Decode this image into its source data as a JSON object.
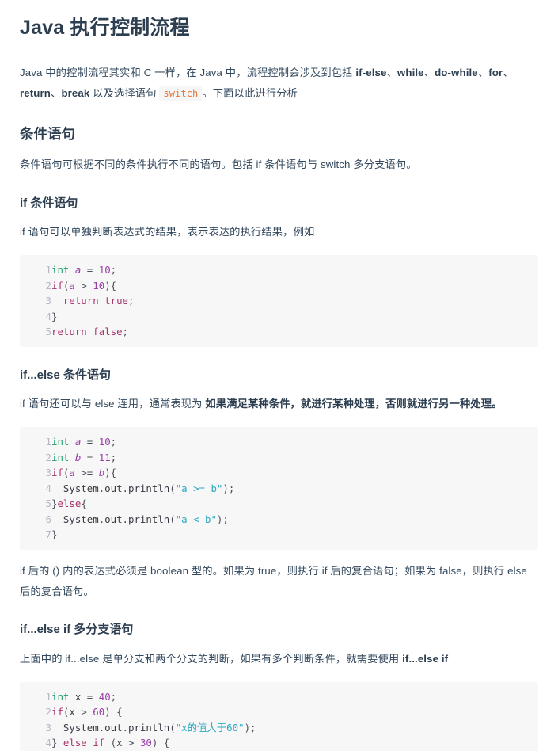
{
  "document": {
    "title": "Java 执行控制流程",
    "intro": {
      "seg1": "Java 中的控制流程其实和 C 一样，在 Java 中，流程控制会涉及到包括 ",
      "kw1": "if-else",
      "sep1": "、",
      "kw2": "while",
      "sep2": "、",
      "kw3": "do-while",
      "sep3": "、",
      "kw4": "for",
      "sep4": "、",
      "kw5": "return",
      "sep5": "、",
      "kw6": "break",
      "seg2": " 以及选择语句 ",
      "code": "switch",
      "seg3": "。下面以此进行分析"
    },
    "sections": [
      {
        "heading": "条件语句",
        "paragraph": "条件语句可根据不同的条件执行不同的语句。包括 if 条件语句与 switch 多分支语句。"
      }
    ],
    "sub_if": {
      "heading": "if 条件语句",
      "paragraph": "if 语句可以单独判断表达式的结果，表示表达的执行结果，例如"
    },
    "sub_ifelse": {
      "heading": "if...else 条件语句",
      "para_pre": "if 语句还可以与 else 连用，通常表现为 ",
      "para_bold": "如果满足某种条件，就进行某种处理，否则就进行另一种处理。",
      "para_after": "if 后的 () 内的表达式必须是 boolean 型的。如果为 true，则执行 if 后的复合语句；如果为 false，则执行 else 后的复合语句。"
    },
    "sub_elseif": {
      "heading": "if...else if 多分支语句",
      "para_pre": "上面中的 if...else 是单分支和两个分支的判断，如果有多个判断条件，就需要使用 ",
      "para_bold": "if...else if"
    },
    "code_blocks": [
      {
        "name": "if-example",
        "lines": [
          {
            "no": "1",
            "tokens": [
              {
                "t": "int",
                "c": "kw"
              },
              {
                "t": " ",
                "c": "punc"
              },
              {
                "t": "a",
                "c": "var"
              },
              {
                "t": " ",
                "c": "punc"
              },
              {
                "t": "=",
                "c": "op"
              },
              {
                "t": " ",
                "c": "punc"
              },
              {
                "t": "10",
                "c": "num"
              },
              {
                "t": ";",
                "c": "punc"
              }
            ]
          },
          {
            "no": "2",
            "tokens": [
              {
                "t": "if",
                "c": "ctrl"
              },
              {
                "t": "(",
                "c": "punc"
              },
              {
                "t": "a",
                "c": "var"
              },
              {
                "t": " ",
                "c": "punc"
              },
              {
                "t": ">",
                "c": "op"
              },
              {
                "t": " ",
                "c": "punc"
              },
              {
                "t": "10",
                "c": "num"
              },
              {
                "t": "){",
                "c": "punc"
              }
            ]
          },
          {
            "no": "3",
            "tokens": [
              {
                "t": "  ",
                "c": "punc"
              },
              {
                "t": "return",
                "c": "ctrl"
              },
              {
                "t": " ",
                "c": "punc"
              },
              {
                "t": "true",
                "c": "bool"
              },
              {
                "t": ";",
                "c": "punc"
              }
            ]
          },
          {
            "no": "4",
            "tokens": [
              {
                "t": "}",
                "c": "punc"
              }
            ]
          },
          {
            "no": "5",
            "tokens": [
              {
                "t": "return",
                "c": "ctrl"
              },
              {
                "t": " ",
                "c": "punc"
              },
              {
                "t": "false",
                "c": "bool"
              },
              {
                "t": ";",
                "c": "punc"
              }
            ]
          }
        ]
      },
      {
        "name": "if-else-example",
        "lines": [
          {
            "no": "1",
            "tokens": [
              {
                "t": "int",
                "c": "kw"
              },
              {
                "t": " ",
                "c": "punc"
              },
              {
                "t": "a",
                "c": "var"
              },
              {
                "t": " ",
                "c": "punc"
              },
              {
                "t": "=",
                "c": "op"
              },
              {
                "t": " ",
                "c": "punc"
              },
              {
                "t": "10",
                "c": "num"
              },
              {
                "t": ";",
                "c": "punc"
              }
            ]
          },
          {
            "no": "2",
            "tokens": [
              {
                "t": "int",
                "c": "kw"
              },
              {
                "t": " ",
                "c": "punc"
              },
              {
                "t": "b",
                "c": "var"
              },
              {
                "t": " ",
                "c": "punc"
              },
              {
                "t": "=",
                "c": "op"
              },
              {
                "t": " ",
                "c": "punc"
              },
              {
                "t": "11",
                "c": "num"
              },
              {
                "t": ";",
                "c": "punc"
              }
            ]
          },
          {
            "no": "3",
            "tokens": [
              {
                "t": "if",
                "c": "ctrl"
              },
              {
                "t": "(",
                "c": "punc"
              },
              {
                "t": "a",
                "c": "var"
              },
              {
                "t": " ",
                "c": "punc"
              },
              {
                "t": ">=",
                "c": "op"
              },
              {
                "t": " ",
                "c": "punc"
              },
              {
                "t": "b",
                "c": "var"
              },
              {
                "t": "){",
                "c": "punc"
              }
            ]
          },
          {
            "no": "4",
            "tokens": [
              {
                "t": "  ",
                "c": "punc"
              },
              {
                "t": "System",
                "c": "id"
              },
              {
                "t": ".",
                "c": "punc"
              },
              {
                "t": "out",
                "c": "id"
              },
              {
                "t": ".",
                "c": "punc"
              },
              {
                "t": "println",
                "c": "id"
              },
              {
                "t": "(",
                "c": "punc"
              },
              {
                "t": "\"a >= b\"",
                "c": "str"
              },
              {
                "t": ");",
                "c": "punc"
              }
            ]
          },
          {
            "no": "5",
            "tokens": [
              {
                "t": "}",
                "c": "punc"
              },
              {
                "t": "else",
                "c": "ctrl"
              },
              {
                "t": "{",
                "c": "punc"
              }
            ]
          },
          {
            "no": "6",
            "tokens": [
              {
                "t": "  ",
                "c": "punc"
              },
              {
                "t": "System",
                "c": "id"
              },
              {
                "t": ".",
                "c": "punc"
              },
              {
                "t": "out",
                "c": "id"
              },
              {
                "t": ".",
                "c": "punc"
              },
              {
                "t": "println",
                "c": "id"
              },
              {
                "t": "(",
                "c": "punc"
              },
              {
                "t": "\"a < b\"",
                "c": "str"
              },
              {
                "t": ");",
                "c": "punc"
              }
            ]
          },
          {
            "no": "7",
            "tokens": [
              {
                "t": "}",
                "c": "punc"
              }
            ]
          }
        ]
      },
      {
        "name": "else-if-example",
        "lines": [
          {
            "no": "1",
            "tokens": [
              {
                "t": "int",
                "c": "kw"
              },
              {
                "t": " ",
                "c": "punc"
              },
              {
                "t": "x",
                "c": "id"
              },
              {
                "t": " ",
                "c": "punc"
              },
              {
                "t": "=",
                "c": "op"
              },
              {
                "t": " ",
                "c": "punc"
              },
              {
                "t": "40",
                "c": "num"
              },
              {
                "t": ";",
                "c": "punc"
              }
            ]
          },
          {
            "no": "2",
            "tokens": [
              {
                "t": "if",
                "c": "ctrl"
              },
              {
                "t": "(",
                "c": "punc"
              },
              {
                "t": "x",
                "c": "id"
              },
              {
                "t": " ",
                "c": "punc"
              },
              {
                "t": ">",
                "c": "op"
              },
              {
                "t": " ",
                "c": "punc"
              },
              {
                "t": "60",
                "c": "num"
              },
              {
                "t": ") {",
                "c": "punc"
              }
            ]
          },
          {
            "no": "3",
            "tokens": [
              {
                "t": "  ",
                "c": "punc"
              },
              {
                "t": "System",
                "c": "id"
              },
              {
                "t": ".",
                "c": "punc"
              },
              {
                "t": "out",
                "c": "id"
              },
              {
                "t": ".",
                "c": "punc"
              },
              {
                "t": "println",
                "c": "id"
              },
              {
                "t": "(",
                "c": "punc"
              },
              {
                "t": "\"x的值大于60\"",
                "c": "str"
              },
              {
                "t": ");",
                "c": "punc"
              }
            ]
          },
          {
            "no": "4",
            "tokens": [
              {
                "t": "} ",
                "c": "punc"
              },
              {
                "t": "else",
                "c": "ctrl"
              },
              {
                "t": " ",
                "c": "punc"
              },
              {
                "t": "if",
                "c": "ctrl"
              },
              {
                "t": " (",
                "c": "punc"
              },
              {
                "t": "x",
                "c": "id"
              },
              {
                "t": " ",
                "c": "punc"
              },
              {
                "t": ">",
                "c": "op"
              },
              {
                "t": " ",
                "c": "punc"
              },
              {
                "t": "30",
                "c": "num"
              },
              {
                "t": ") {",
                "c": "punc"
              }
            ]
          }
        ]
      }
    ]
  },
  "theme": {
    "title_color": "#2c3e50",
    "body_color": "#34495e",
    "code_bg": "#f7f7f8",
    "inline_code_color": "#e8763a",
    "rule_color": "#e7e7e7",
    "keyword_color": "#1f9c6e",
    "control_color": "#a8336e",
    "number_color": "#9b3fa8",
    "string_color": "#2aa9bf",
    "linenumber_color": "#b9b4c6"
  }
}
